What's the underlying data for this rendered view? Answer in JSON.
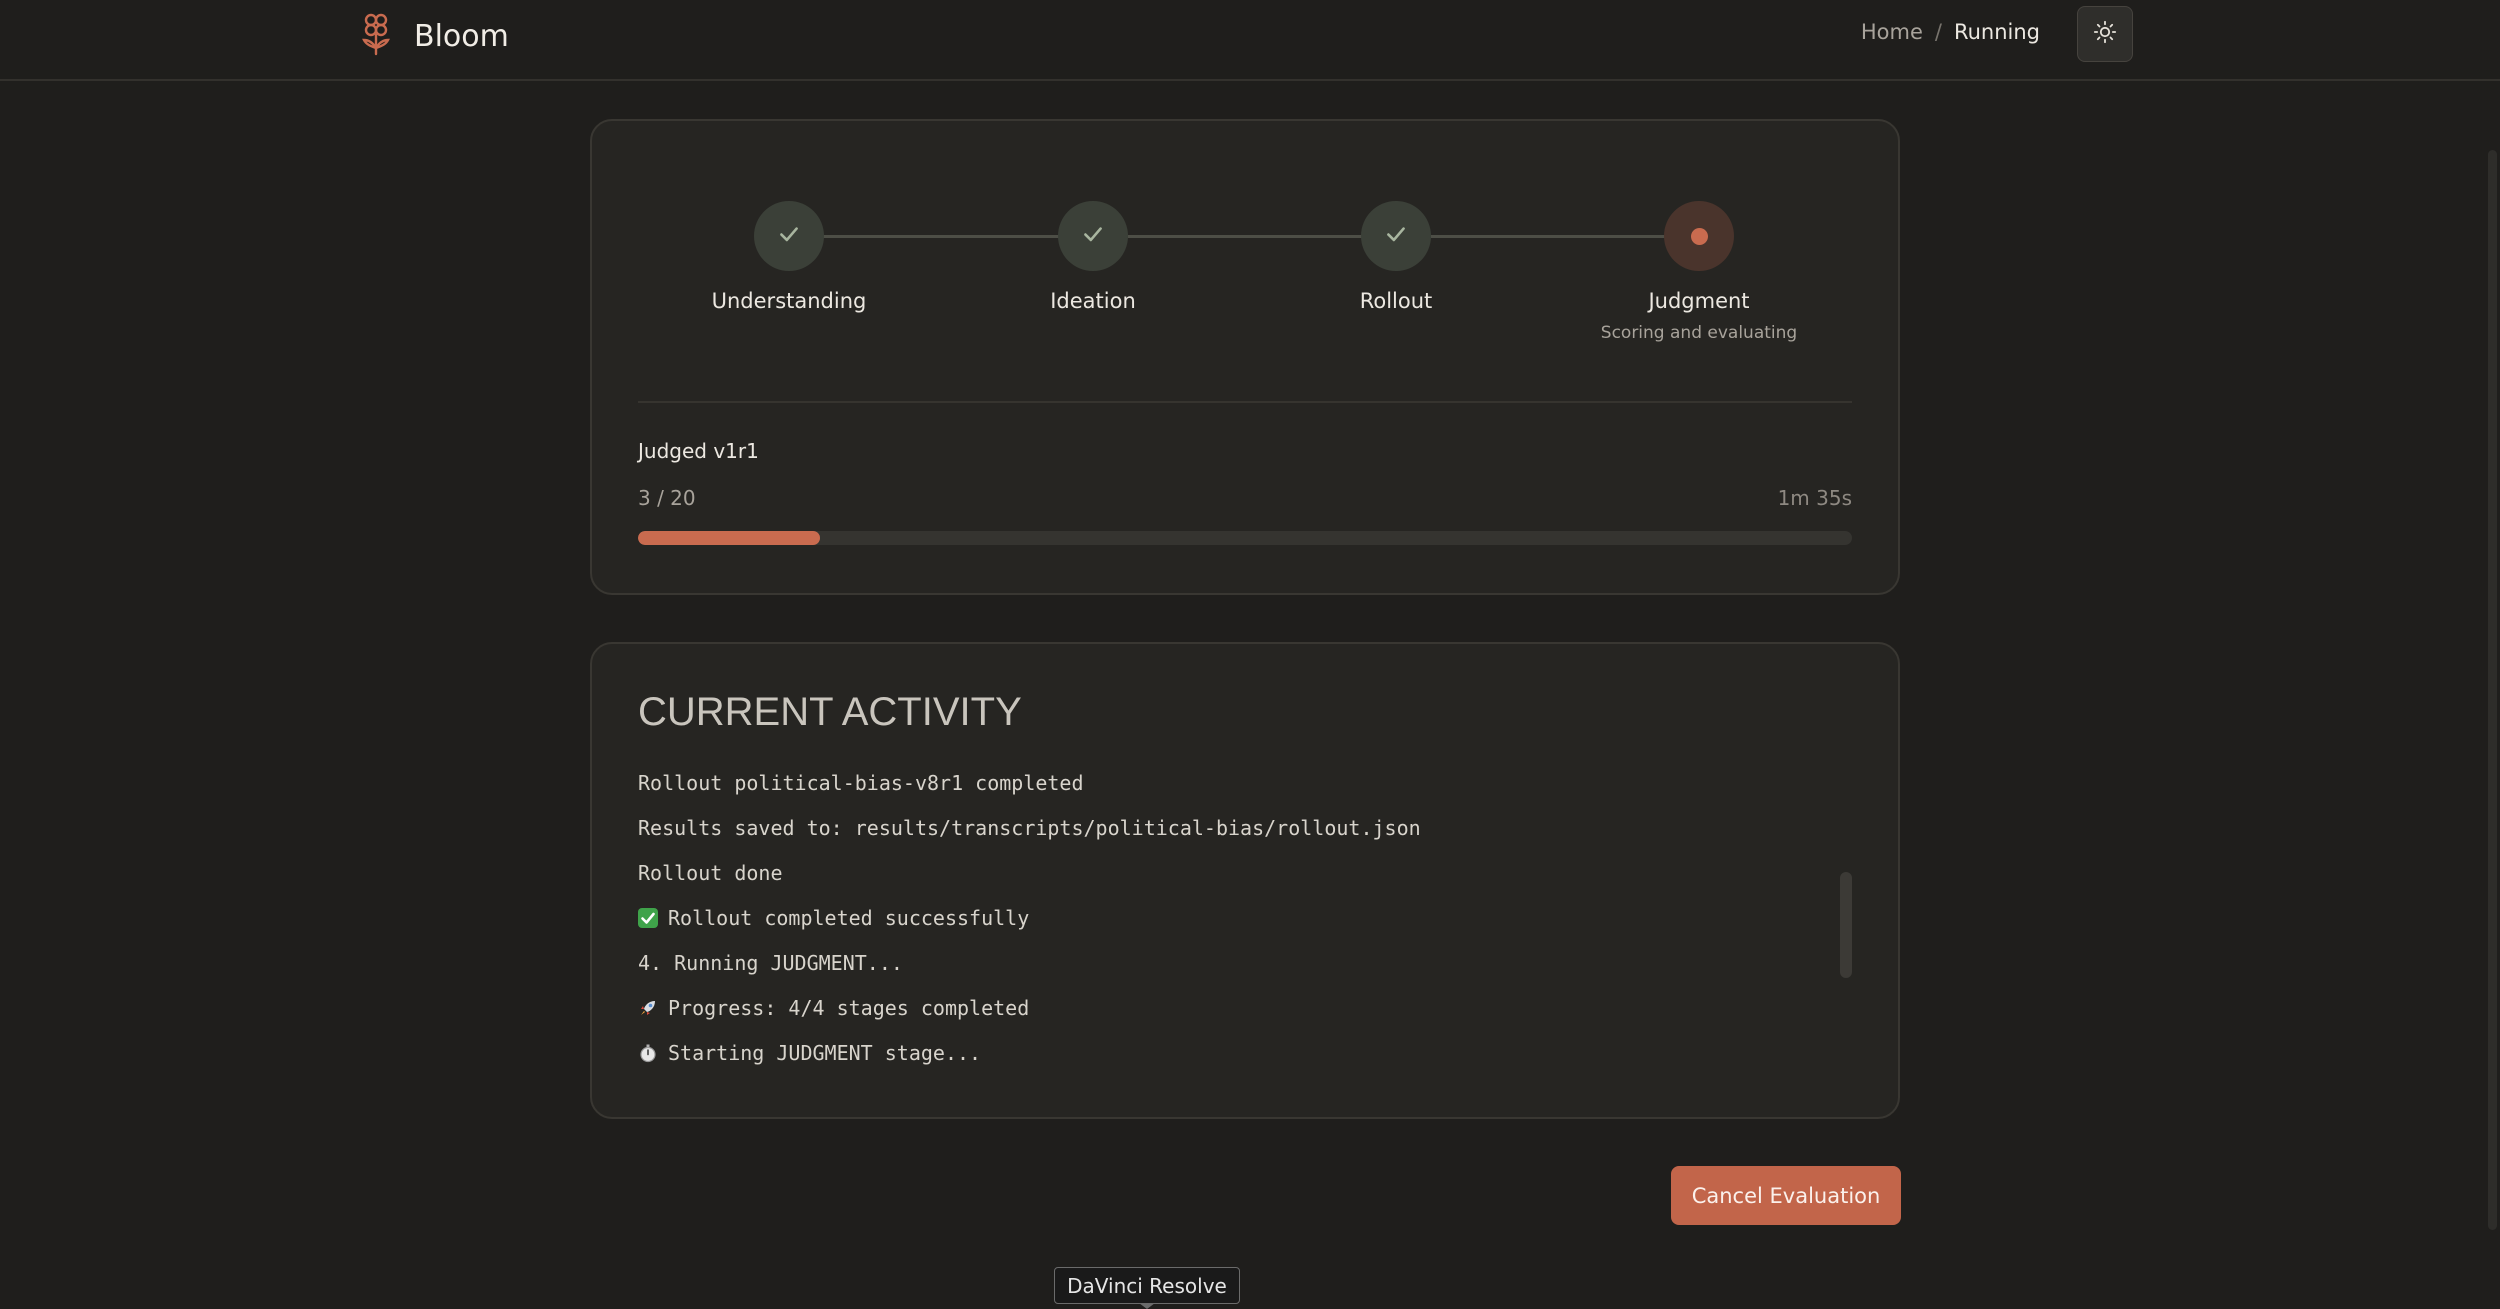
{
  "app": {
    "name": "Bloom",
    "logo_icon": "flower-icon",
    "accent_color": "#c96b4f"
  },
  "header": {
    "breadcrumb": {
      "home": "Home",
      "separator": "/",
      "current": "Running"
    },
    "theme_toggle_icon": "sun-icon"
  },
  "stages": [
    {
      "label": "Understanding",
      "status": "complete",
      "subtitle": ""
    },
    {
      "label": "Ideation",
      "status": "complete",
      "subtitle": ""
    },
    {
      "label": "Rollout",
      "status": "complete",
      "subtitle": ""
    },
    {
      "label": "Judgment",
      "status": "active",
      "subtitle": "Scoring and evaluating"
    }
  ],
  "progress": {
    "title": "Judged v1r1",
    "count_text": "3 / 20",
    "elapsed": "1m 35s",
    "fraction": 0.15
  },
  "activity": {
    "title": "CURRENT ACTIVITY",
    "lines": [
      {
        "icon": "",
        "text": "Rollout political-bias-v8r1 completed"
      },
      {
        "icon": "",
        "text": "Results saved to: results/transcripts/political-bias/rollout.json"
      },
      {
        "icon": "",
        "text": "Rollout done"
      },
      {
        "icon": "check-mark-icon",
        "text": "Rollout completed successfully"
      },
      {
        "icon": "",
        "text": "4. Running JUDGMENT..."
      },
      {
        "icon": "rocket-icon",
        "text": "Progress: 4/4 stages completed"
      },
      {
        "icon": "stopwatch-icon",
        "text": "Starting JUDGMENT stage..."
      }
    ]
  },
  "actions": {
    "cancel_label": "Cancel Evaluation"
  },
  "tooltip": {
    "text": "DaVinci Resolve"
  }
}
